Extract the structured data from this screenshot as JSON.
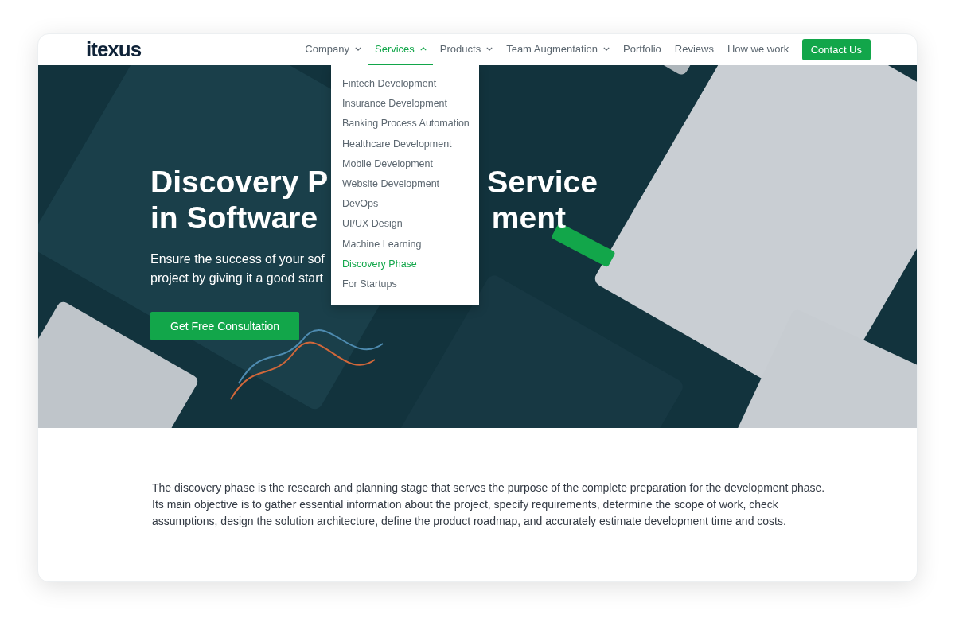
{
  "logo": "itexus",
  "nav": [
    {
      "label": "Company",
      "dropdown": true,
      "selected": false
    },
    {
      "label": "Services",
      "dropdown": true,
      "selected": true
    },
    {
      "label": "Products",
      "dropdown": true,
      "selected": false
    },
    {
      "label": "Team Augmentation",
      "dropdown": true,
      "selected": false
    },
    {
      "label": "Portfolio",
      "dropdown": false,
      "selected": false
    },
    {
      "label": "Reviews",
      "dropdown": false,
      "selected": false
    },
    {
      "label": "How we work",
      "dropdown": false,
      "selected": false
    }
  ],
  "contact_button": "Contact Us",
  "services_menu": [
    {
      "label": "Fintech Development",
      "selected": false
    },
    {
      "label": "Insurance Development",
      "selected": false
    },
    {
      "label": "Banking Process Automation",
      "selected": false
    },
    {
      "label": "Healthcare Development",
      "selected": false
    },
    {
      "label": "Mobile Development",
      "selected": false
    },
    {
      "label": "Website Development",
      "selected": false
    },
    {
      "label": "DevOps",
      "selected": false
    },
    {
      "label": "UI/UX Design",
      "selected": false
    },
    {
      "label": "Machine Learning",
      "selected": false
    },
    {
      "label": "Discovery Phase",
      "selected": true
    },
    {
      "label": "For Startups",
      "selected": false
    }
  ],
  "hero": {
    "title_lines": [
      [
        "Discovery P",
        "Service"
      ],
      [
        "in Software",
        "ment"
      ]
    ],
    "subtitle_lines": [
      "Ensure the success of your sof",
      "project by giving it a good start"
    ],
    "button": "Get Free Consultation"
  },
  "intro": "The discovery phase is the research and planning stage that serves the purpose of the complete preparation for the development phase. Its main objective is to gather essential information about the project, specify requirements, determine the scope of work, check assumptions, design the solution architecture, define the product roadmap, and accurately estimate development time and costs."
}
